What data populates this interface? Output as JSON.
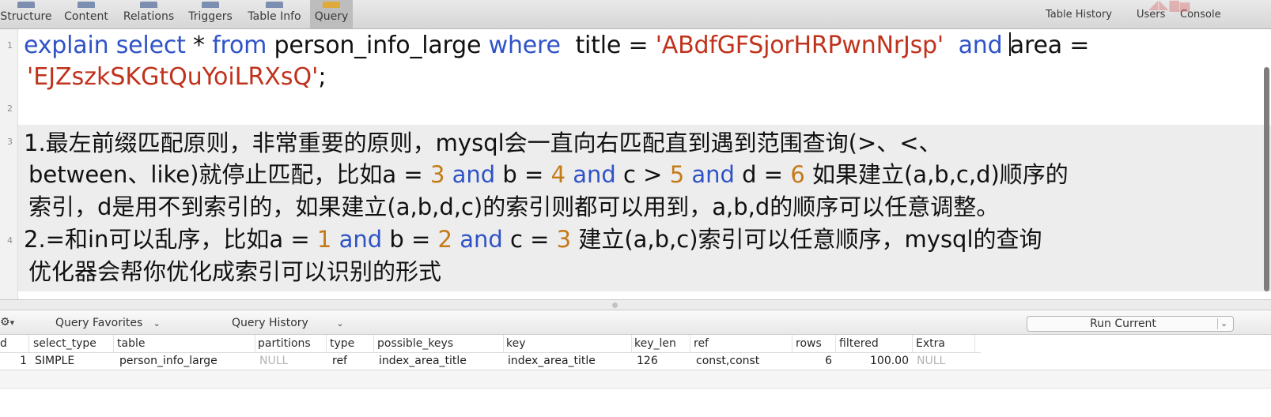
{
  "toolbar": {
    "tabs": [
      {
        "label": "Structure",
        "icon": "structure-icon"
      },
      {
        "label": "Content",
        "icon": "content-icon"
      },
      {
        "label": "Relations",
        "icon": "relations-icon"
      },
      {
        "label": "Triggers",
        "icon": "triggers-icon"
      },
      {
        "label": "Table Info",
        "icon": "table-info-icon"
      },
      {
        "label": "Query",
        "icon": "query-icon",
        "active": true
      }
    ],
    "right": [
      "Table History",
      "Users",
      "Console"
    ]
  },
  "editor": {
    "line_numbers": [
      "1",
      "2",
      "3",
      "4"
    ],
    "line1": {
      "kw_explain": "explain",
      "kw_select": "select",
      "star": "*",
      "kw_from": "from",
      "table_name": "person_info_large",
      "kw_where": "where",
      "col_title": "title",
      "eq1": "=",
      "str_title": "'ABdfGFSjorHRPwnNrJsp'",
      "kw_and": "and",
      "col_area": "area",
      "eq2": "=",
      "str_area": "'EJZszkSKGtQuYoiLRXsQ'",
      "semicolon": ";"
    },
    "line3": {
      "a": "1.最左前缀匹配原则，非常重要的原则，mysql会一直向右匹配直到遇到范围查询(>、<、",
      "b_pre": "between、like)就停止匹配，比如a =",
      "b_n1": "3",
      "b_and1": "and",
      "b_mid1": "b =",
      "b_n2": "4",
      "b_and2": "and",
      "b_mid2": "c >",
      "b_n3": "5",
      "b_and3": "and",
      "b_mid3": "d =",
      "b_n4": "6",
      "b_post": "如果建立(a,b,c,d)顺序的",
      "c": "索引，d是用不到索引的，如果建立(a,b,d,c)的索引则都可以用到，a,b,d的顺序可以任意调整。"
    },
    "line4": {
      "a_pre": "2.=和in可以乱序，比如a =",
      "a_n1": "1",
      "a_and1": "and",
      "a_mid1": "b =",
      "a_n2": "2",
      "a_and2": "and",
      "a_mid2": "c =",
      "a_n3": "3",
      "a_post": "建立(a,b,c)索引可以任意顺序，mysql的查询",
      "b": "优化器会帮你优化成索引可以识别的形式"
    },
    "colors": {
      "keyword": "#2f53c7",
      "string": "#c0321c",
      "number": "#c57a18"
    }
  },
  "query_bar": {
    "settings_icon": "gear-icon",
    "favorites_label": "Query Favorites",
    "history_label": "Query History",
    "run_label": "Run Current"
  },
  "results": {
    "columns": [
      "d",
      "select_type",
      "table",
      "partitions",
      "type",
      "possible_keys",
      "key",
      "key_len",
      "ref",
      "rows",
      "filtered",
      "Extra"
    ],
    "rows": [
      [
        "1",
        "SIMPLE",
        "person_info_large",
        "NULL",
        "ref",
        "index_area_title",
        "index_area_title",
        "126",
        "const,const",
        "6",
        "100.00",
        "NULL"
      ]
    ]
  }
}
